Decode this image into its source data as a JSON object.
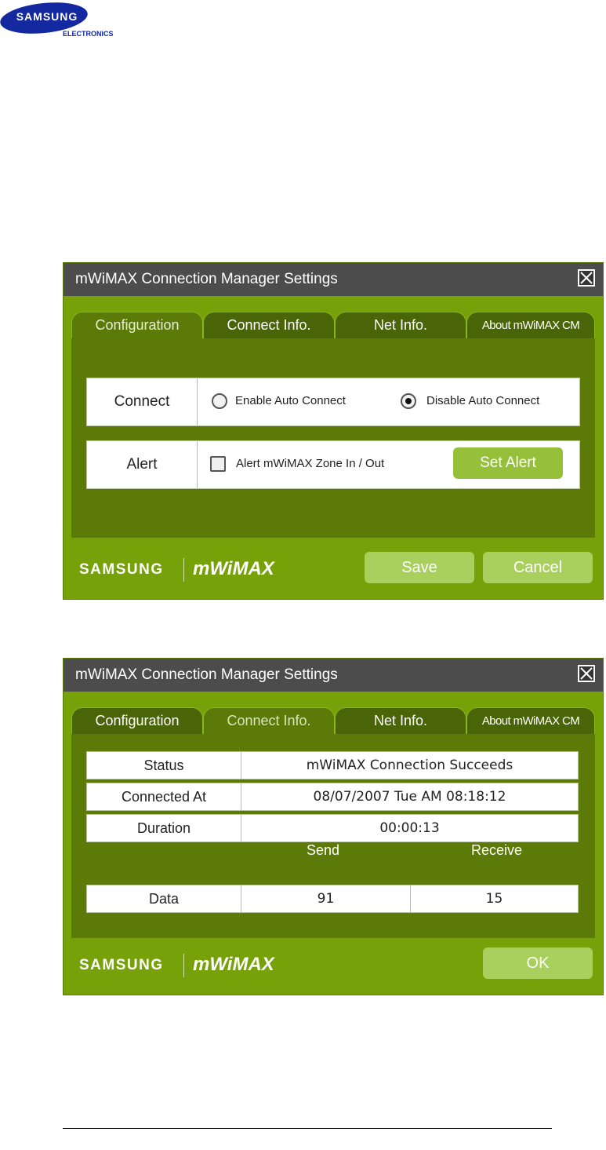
{
  "header": {
    "logo_text": "SAMSUNG",
    "logo_sub": "ELECTRONICS"
  },
  "window_a": {
    "title": "mWiMAX Connection Manager Settings",
    "tabs": [
      "Configuration",
      "Connect Info.",
      "Net Info.",
      "About mWiMAX CM"
    ],
    "active_tab": "Configuration",
    "connect": {
      "label": "Connect",
      "option_enable": "Enable Auto Connect",
      "option_disable": "Disable Auto Connect",
      "selected": "Disable Auto Connect"
    },
    "alert": {
      "label": "Alert",
      "checkbox_label": "Alert mWiMAX Zone In / Out",
      "checked": false,
      "set_alert_label": "Set Alert"
    },
    "footer": {
      "brand_samsung": "SAMSUNG",
      "brand_product": "mWiMAX",
      "save_label": "Save",
      "cancel_label": "Cancel"
    }
  },
  "window_b": {
    "title": "mWiMAX Connection Manager Settings",
    "tabs": [
      "Configuration",
      "Connect Info.",
      "Net Info.",
      "About mWiMAX CM"
    ],
    "active_tab": "Connect Info.",
    "info": {
      "status_label": "Status",
      "status_value": "mWiMAX Connection Succeeds",
      "connected_at_label": "Connected At",
      "connected_at_value": "08/07/2007 Tue AM 08:18:12",
      "duration_label": "Duration",
      "duration_value": "00:00:13",
      "send_header": "Send",
      "receive_header": "Receive",
      "data_label": "Data",
      "send_value": "91",
      "receive_value": "15"
    },
    "footer": {
      "brand_samsung": "SAMSUNG",
      "brand_product": "mWiMAX",
      "ok_label": "OK"
    }
  },
  "colors": {
    "window_green": "#76a108",
    "panel_green": "#5b7a08",
    "titlebar": "#4c4c4c",
    "button_green": "#a9cf5d",
    "samsung_blue": "#1428a0"
  }
}
